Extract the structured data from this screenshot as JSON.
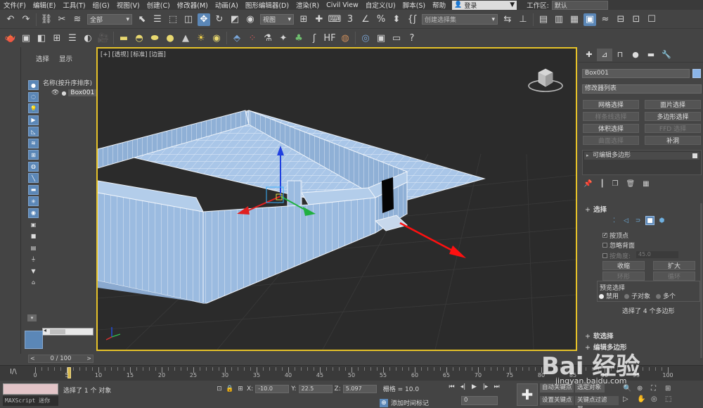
{
  "menu": {
    "items": [
      "文件(F)",
      "编辑(E)",
      "工具(T)",
      "组(G)",
      "视图(V)",
      "创建(C)",
      "修改器(M)",
      "动画(A)",
      "图形编辑器(D)",
      "渲染(R)",
      "Civil View",
      "自定义(U)",
      "脚本(S)",
      "帮助"
    ],
    "login": "登录",
    "workspace_label": "工作区:",
    "workspace_value": "默认"
  },
  "toolbar": {
    "filter_value": "全部",
    "refcoord_value": "视图",
    "selset_placeholder": "创建选择集"
  },
  "explorer": {
    "tab_select": "选择",
    "tab_display": "显示",
    "header": "名称(按升序排序)",
    "object": "Box001"
  },
  "viewport": {
    "label": "[+] [透视] [标准] [边面]"
  },
  "command_panel": {
    "object_name": "Box001",
    "modifier_list": "修改器列表",
    "buttons": [
      {
        "label": "网格选择",
        "enabled": true
      },
      {
        "label": "面片选择",
        "enabled": true
      },
      {
        "label": "样条线选择",
        "enabled": false
      },
      {
        "label": "多边形选择",
        "enabled": true
      },
      {
        "label": "体积选择",
        "enabled": true
      },
      {
        "label": "FFD 选择",
        "enabled": false
      },
      {
        "label": "曲面选择",
        "enabled": false
      },
      {
        "label": "补洞",
        "enabled": true
      }
    ],
    "stack_item": "可编辑多边形",
    "rollout_select": "选择",
    "by_vertex": "按顶点",
    "ignore_backface": "忽略背面",
    "by_angle": "按角度:",
    "angle_value": "45.0",
    "shrink": "收缩",
    "grow": "扩大",
    "ring": "环形",
    "loop": "循环",
    "preview_title": "预览选择",
    "preview_off": "禁用",
    "preview_subobj": "子对象",
    "preview_multi": "多个",
    "status": "选择了 4 个多边形",
    "rollout_soft": "软选择",
    "rollout_edit": "编辑多边形"
  },
  "timeline": {
    "frame_display": "0 / 100",
    "ticks": [
      0,
      5,
      10,
      15,
      20,
      25,
      30,
      35,
      40,
      45,
      50,
      55,
      60,
      65,
      70,
      75,
      80,
      85,
      90,
      95,
      100
    ]
  },
  "status": {
    "script_label": "MAXScript 迷你",
    "selected_msg": "选择了 1 个 对象",
    "x_label": "X:",
    "x_value": "-10.0",
    "y_label": "Y:",
    "y_value": "22.5",
    "z_label": "Z:",
    "z_value": "5.097",
    "grid_label": "栅格 = 10.0",
    "add_time_tag": "添加时间标记",
    "frame_value": "0",
    "auto_key": "自动关键点",
    "selected_obj": "选定对象",
    "set_key": "设置关键点",
    "key_filters": "关键点过滤器..."
  },
  "watermark": {
    "brand": "Bai 经验",
    "url": "jingyan.baidu.com"
  }
}
